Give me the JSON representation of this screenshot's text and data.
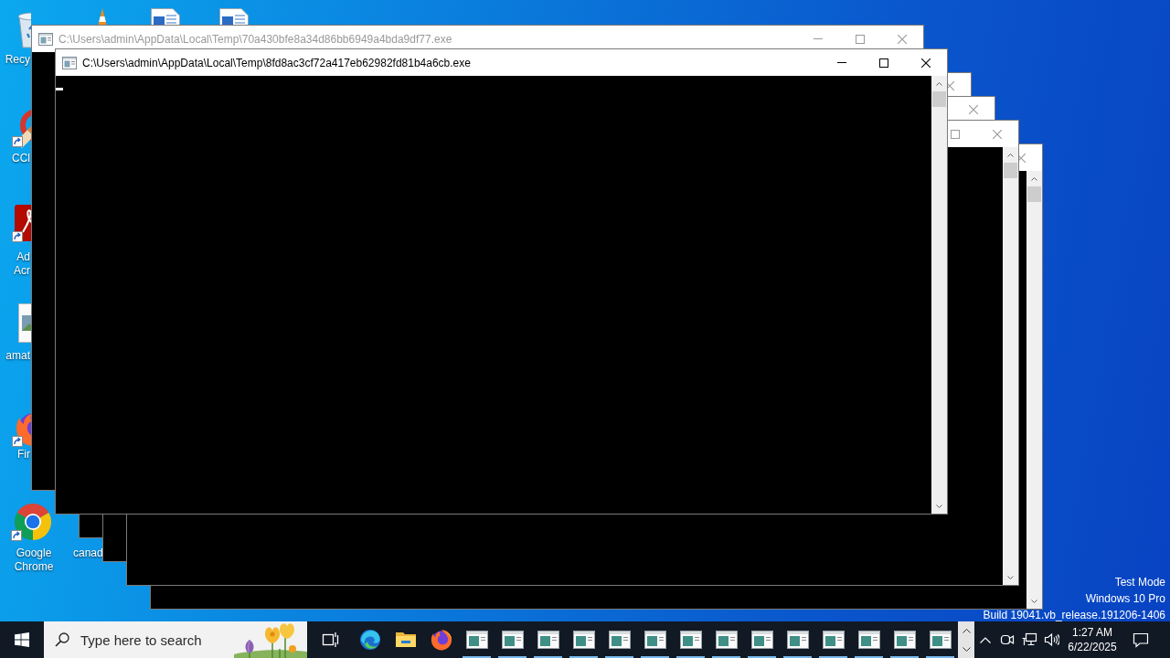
{
  "desktop": {
    "icons": [
      {
        "kind": "bin",
        "label": "Recy",
        "shortcut": false
      },
      {
        "kind": "cone"
      },
      {
        "kind": "document"
      },
      {
        "kind": "document"
      },
      {
        "kind": "brush",
        "label": "CCl",
        "shortcut": true
      },
      {
        "kind": "pdf",
        "label": "Ad Acr",
        "shortcut": true
      },
      {
        "kind": "picture",
        "label": "amat",
        "shortcut": false
      },
      {
        "kind": "fox",
        "label": "Fir",
        "shortcut": true
      },
      {
        "kind": "chrome",
        "label": "Google Chrome",
        "shortcut": true
      },
      {
        "label": "canad"
      }
    ],
    "system_text": [
      "Test Mode",
      "Windows 10 Pro",
      "Build 19041.vb_release.191206-1406"
    ]
  },
  "windows": [
    {
      "title": "C:\\Users\\admin\\AppData\\Local\\Temp\\70a430bfe8a34d86bb6949a4bda9df77.exe",
      "active": false,
      "controls": [
        {
          "kind": "minimize"
        },
        {
          "kind": "maximize"
        },
        {
          "kind": "close"
        }
      ],
      "cursor": false
    },
    {
      "title": "C:\\Users\\admin\\AppData\\Local\\Temp\\8fd8ac3cf72a417eb62982fd81b4a6cb.exe",
      "active": true,
      "controls": [
        {
          "kind": "minimize"
        },
        {
          "kind": "maximize"
        },
        {
          "kind": "close"
        }
      ],
      "scrollbar": true,
      "cursor": true
    },
    {
      "active": false,
      "controls": [
        {
          "kind": "close"
        }
      ]
    },
    {
      "active": false,
      "controls": [
        {
          "kind": "close"
        }
      ]
    },
    {
      "active": false,
      "controls": [
        {
          "kind": "maximize"
        },
        {
          "kind": "close"
        }
      ],
      "scrollbar": true
    },
    {
      "active": false,
      "controls": [
        {
          "kind": "close"
        }
      ],
      "scrollbar": true
    }
  ],
  "taskbar": {
    "search": {
      "placeholder": "Type here to search"
    },
    "apps": [
      {
        "kind": "edge",
        "running": false
      },
      {
        "kind": "folder",
        "running": false
      },
      {
        "kind": "firefox",
        "running": false
      },
      {
        "kind": "console",
        "running": true
      },
      {
        "kind": "console",
        "running": true
      },
      {
        "kind": "console",
        "running": true
      },
      {
        "kind": "console",
        "running": true
      },
      {
        "kind": "console",
        "running": true
      },
      {
        "kind": "console",
        "running": true
      },
      {
        "kind": "console",
        "running": true
      },
      {
        "kind": "console",
        "running": true
      },
      {
        "kind": "console",
        "running": true
      },
      {
        "kind": "console",
        "running": true
      },
      {
        "kind": "console",
        "running": true
      },
      {
        "kind": "console",
        "running": true
      },
      {
        "kind": "console",
        "running": true
      },
      {
        "kind": "console",
        "running": true
      }
    ],
    "clock": {
      "time": "1:27 AM",
      "date": "6/22/2025"
    }
  }
}
